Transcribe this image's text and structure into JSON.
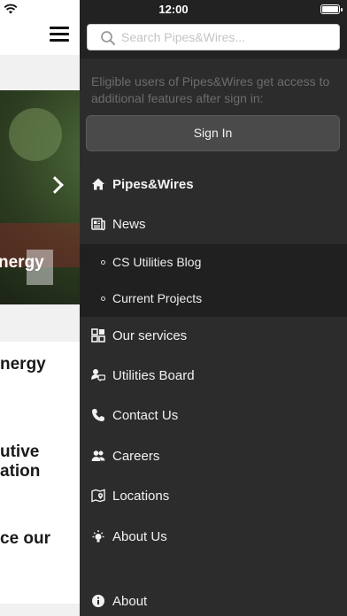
{
  "status_bar": {
    "time": "12:00"
  },
  "background": {
    "hero_title": "nergy",
    "body_lines": [
      "nergy",
      "utive",
      "ation",
      "ce our"
    ]
  },
  "drawer": {
    "search": {
      "placeholder": "Search Pipes&Wires..."
    },
    "signin_note": "Eligible users of Pipes&Wires get access to additional features after sign in:",
    "signin_button": "Sign In",
    "menu": [
      {
        "label": "Pipes&Wires",
        "icon": "home-icon",
        "active": true
      },
      {
        "label": "News",
        "icon": "newspaper-icon",
        "active": false
      },
      {
        "label": "CS Utilities Blog",
        "sub": true
      },
      {
        "label": "Current Projects",
        "sub": true
      },
      {
        "label": "Our services",
        "icon": "grid-icon",
        "active": false
      },
      {
        "label": "Utilities Board",
        "icon": "person-chat-icon",
        "active": false
      },
      {
        "label": "Contact Us",
        "icon": "phone-icon",
        "active": false
      },
      {
        "label": "Careers",
        "icon": "people-icon",
        "active": false
      },
      {
        "label": "Locations",
        "icon": "map-pin-icon",
        "active": false
      },
      {
        "label": "About Us",
        "icon": "lightbulb-icon",
        "active": false
      },
      {
        "label": "About",
        "icon": "info-icon",
        "active": false
      }
    ]
  },
  "colors": {
    "drawer_bg": "#2c2c2c",
    "drawer_header_bg": "#222222",
    "submenu_bg": "#202020",
    "signin_button_bg": "#4a4a4a"
  }
}
